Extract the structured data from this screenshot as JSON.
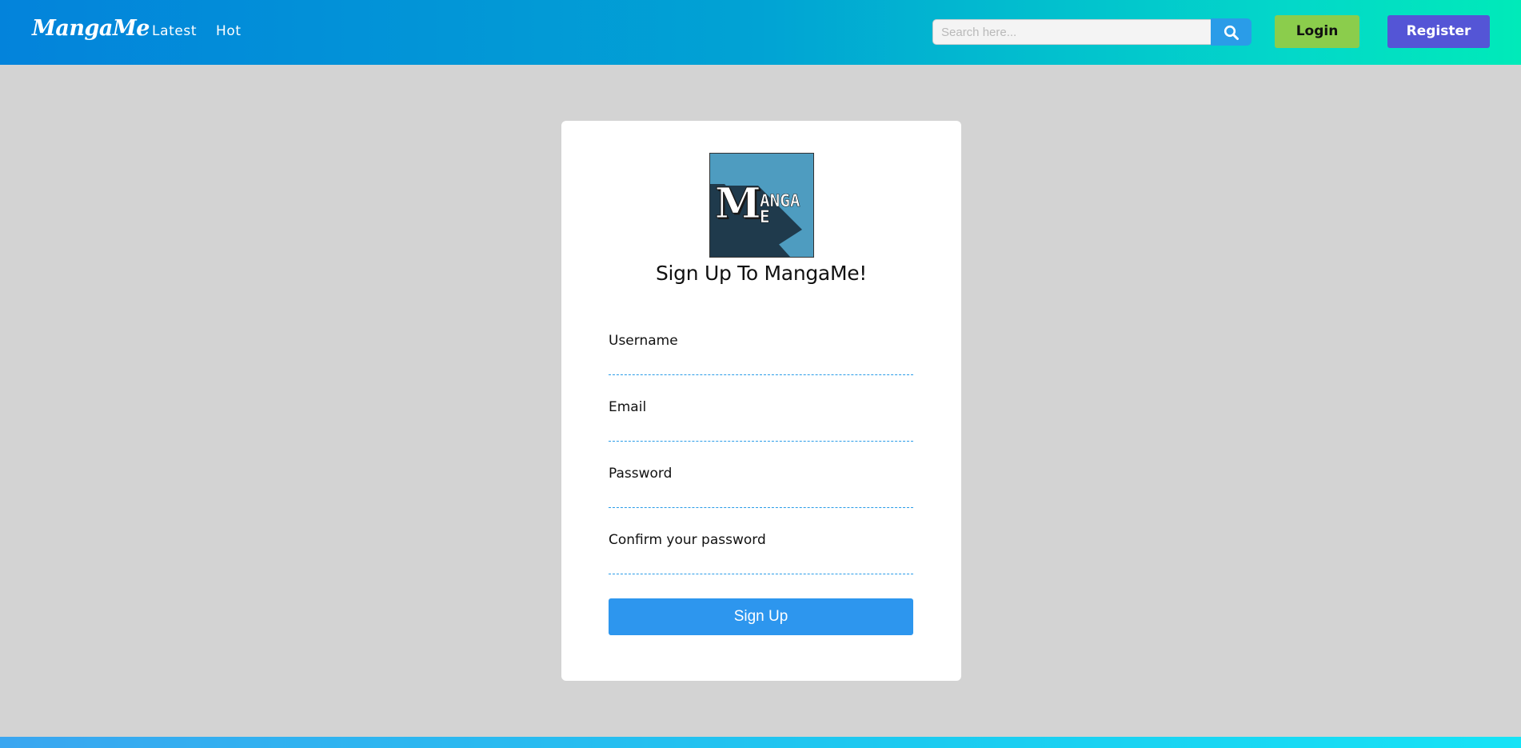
{
  "header": {
    "brand": "MangaMe",
    "nav": {
      "latest": "Latest",
      "hot": "Hot"
    },
    "search": {
      "placeholder": "Search here...",
      "value": ""
    },
    "login_label": "Login",
    "register_label": "Register"
  },
  "signup": {
    "logo": {
      "big_letter": "M",
      "top_text": "ANGA",
      "bottom_text": "E"
    },
    "title": "Sign Up To MangaMe!",
    "fields": {
      "username_label": "Username",
      "email_label": "Email",
      "password_label": "Password",
      "confirm_label": "Confirm your password"
    },
    "submit_label": "Sign Up"
  },
  "colors": {
    "header_gradient_start": "#0383db",
    "header_gradient_end": "#00eab9",
    "page_background": "#d3d3d3",
    "login_button": "#8bcd4c",
    "register_button": "#5455d6",
    "signup_button": "#2d96ee",
    "input_underline": "#2a9ce8"
  },
  "icons": {
    "search": "search-icon"
  }
}
